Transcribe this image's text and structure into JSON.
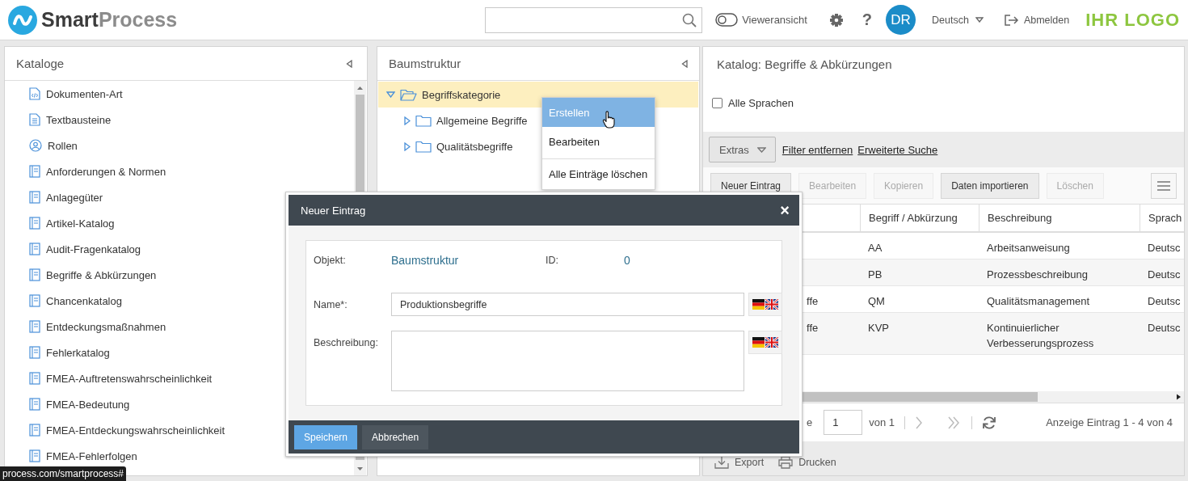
{
  "header": {
    "brand_dark": "Smart",
    "brand_light": "Process",
    "viewer_toggle": {
      "label": "Vieweransicht",
      "on": false
    },
    "help": "?",
    "avatar": "DR",
    "language": "Deutsch",
    "logout": "Abmelden",
    "partner_logo": "IHR LOGO"
  },
  "catalogs": {
    "title": "Kataloge",
    "items": [
      {
        "label": "Dokumenten-Art",
        "kind": "code"
      },
      {
        "label": "Textbausteine",
        "kind": "doc"
      },
      {
        "label": "Rollen",
        "kind": "user"
      },
      {
        "label": "Anforderungen & Normen",
        "kind": "catalog"
      },
      {
        "label": "Anlagegüter",
        "kind": "catalog"
      },
      {
        "label": "Artikel-Katalog",
        "kind": "catalog"
      },
      {
        "label": "Audit-Fragenkatalog",
        "kind": "catalog"
      },
      {
        "label": "Begriffe & Abkürzungen",
        "kind": "catalog"
      },
      {
        "label": "Chancenkatalog",
        "kind": "catalog"
      },
      {
        "label": "Entdeckungsmaßnahmen",
        "kind": "catalog"
      },
      {
        "label": "Fehlerkatalog",
        "kind": "catalog"
      },
      {
        "label": "FMEA-Auftretenswahrscheinlichkeit",
        "kind": "catalog"
      },
      {
        "label": "FMEA-Bedeutung",
        "kind": "catalog"
      },
      {
        "label": "FMEA-Entdeckungswahrscheinlichkeit",
        "kind": "catalog"
      },
      {
        "label": "FMEA-Fehlerfolgen",
        "kind": "catalog"
      }
    ]
  },
  "tree": {
    "title": "Baumstruktur",
    "nodes": [
      {
        "label": "Begriffskategorie",
        "expanded": true,
        "selected": true,
        "children": [
          {
            "label": "Allgemeine Begriffe",
            "expanded": false,
            "selected": false
          },
          {
            "label": "Qualitätsbegriffe",
            "expanded": false,
            "selected": false
          }
        ]
      }
    ]
  },
  "context_menu": {
    "items": [
      {
        "label": "Erstellen",
        "selected": true,
        "separator_before": false
      },
      {
        "label": "Bearbeiten",
        "selected": false,
        "separator_before": false
      },
      {
        "label": "Alle Einträge löschen",
        "selected": false,
        "separator_before": true
      }
    ]
  },
  "detail": {
    "title": "Katalog: Begriffe & Abkürzungen",
    "all_languages": {
      "label": "Alle Sprachen",
      "checked": false
    },
    "extras": "Extras",
    "links": [
      "Filter entfernen",
      "Erweiterte Suche"
    ],
    "buttons": [
      {
        "label": "Neuer Eintrag",
        "disabled": false
      },
      {
        "label": "Bearbeiten",
        "disabled": true
      },
      {
        "label": "Kopieren",
        "disabled": true
      },
      {
        "label": "Daten importieren",
        "disabled": false
      },
      {
        "label": "Löschen",
        "disabled": true
      }
    ],
    "columns": [
      "Begriff / Abkürzung",
      "Beschreibung",
      "Sprach"
    ],
    "rows": [
      {
        "term": "AA",
        "description": "Arbeitsanweisung",
        "language": "Deutsc"
      },
      {
        "term": "PB",
        "description": "Prozessbeschreibung",
        "language": "Deutsc"
      },
      {
        "column_1": "ffe",
        "term": "QM",
        "description": "Qualitätsmanagement",
        "language": "Deutsc"
      },
      {
        "column_1": "ffe",
        "term": "KVP",
        "description": "Kontinuierlicher Verbesserungsprozess",
        "language": "Deutsc"
      }
    ],
    "pager": {
      "page_label": "e",
      "page": "1",
      "page_count": "von 1",
      "info": "Anzeige Eintrag 1 - 4 von 4"
    },
    "footer": [
      {
        "label": "Export",
        "kind": "export"
      },
      {
        "label": "Drucken",
        "kind": "print"
      }
    ]
  },
  "dialog": {
    "title": "Neuer Eintrag",
    "close": "×",
    "object_label": "Objekt:",
    "object_value": "Baumstruktur",
    "id_label": "ID:",
    "id_value": "0",
    "name_label": "Name*:",
    "name_value": "Produktionsbegriffe",
    "description_label": "Beschreibung:",
    "buttons": [
      {
        "label": "Speichern",
        "kind": "primary"
      },
      {
        "label": "Abbrechen",
        "kind": "secondary"
      }
    ]
  },
  "status_url": "process.com/smartprocess#"
}
